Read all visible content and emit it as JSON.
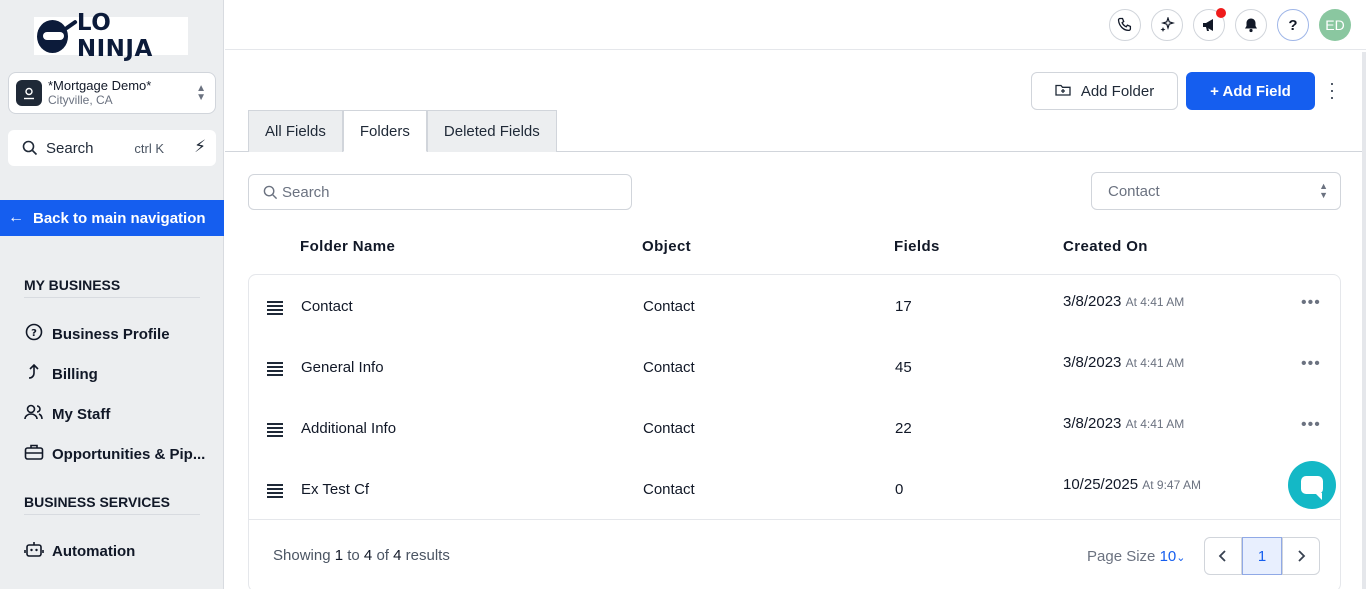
{
  "brand": {
    "logo_text": "LO NINJA"
  },
  "account": {
    "name": "*Mortgage Demo*",
    "location": "Cityville, CA",
    "icon": "location-pin-icon"
  },
  "sidebar_search": {
    "label": "Search",
    "shortcut": "ctrl K"
  },
  "back_nav": {
    "label": "Back to main navigation"
  },
  "sections": {
    "my_business": "MY BUSINESS",
    "business_services": "BUSINESS SERVICES"
  },
  "nav": {
    "business_profile": "Business Profile",
    "billing": "Billing",
    "my_staff": "My Staff",
    "opportunities": "Opportunities & Pip...",
    "automation": "Automation"
  },
  "topbar": {
    "icons": [
      "phone-icon",
      "sparkle-icon",
      "megaphone-icon",
      "bell-icon",
      "help-icon"
    ],
    "help_glyph": "?",
    "avatar_initials": "ED"
  },
  "actions": {
    "add_folder": "Add Folder",
    "add_field": "+ Add Field"
  },
  "tabs": [
    "All Fields",
    "Folders",
    "Deleted Fields"
  ],
  "active_tab": "Folders",
  "filters": {
    "search_placeholder": "Search",
    "object_select": "Contact"
  },
  "table": {
    "headers": {
      "folder": "Folder Name",
      "object": "Object",
      "fields": "Fields",
      "created": "Created On"
    },
    "rows": [
      {
        "name": "Contact",
        "object": "Contact",
        "fields": "17",
        "date": "3/8/2023",
        "time": "At 4:41 AM",
        "has_menu": true
      },
      {
        "name": "General Info",
        "object": "Contact",
        "fields": "45",
        "date": "3/8/2023",
        "time": "At 4:41 AM",
        "has_menu": true
      },
      {
        "name": "Additional Info",
        "object": "Contact",
        "fields": "22",
        "date": "3/8/2023",
        "time": "At 4:41 AM",
        "has_menu": true
      },
      {
        "name": "Ex Test Cf",
        "object": "Contact",
        "fields": "0",
        "date": "10/25/2025",
        "time": "At 9:47 AM",
        "has_menu": false
      }
    ]
  },
  "pagination": {
    "showing_prefix": "Showing",
    "from": "1",
    "to_word": "to",
    "to": "4",
    "of_word": "of",
    "total": "4",
    "suffix": "results",
    "page_size_label": "Page Size",
    "page_size": "10",
    "current_page": "1"
  },
  "colors": {
    "primary": "#155eef",
    "sidebar_bg": "#eceef0",
    "chat": "#14b8c6",
    "avatar": "#8ac7a0",
    "notification_dot": "#ef1b1b"
  }
}
